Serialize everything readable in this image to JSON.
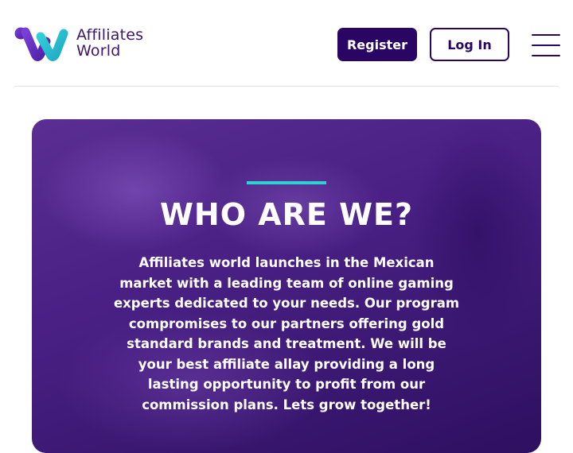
{
  "header": {
    "brand": {
      "line1": "Affiliates",
      "line2": "World"
    },
    "register_label": "Register",
    "login_label": "Log In"
  },
  "hero": {
    "title": "WHO ARE WE?",
    "body": "Affiliates world launches in the Mexican market with a leading team of online gaming experts dedicated to your needs. Our program compromises to our partners offering gold standard brands and treatment. We will be your best affiliate allay providing a long lasting opportunity to profit from our commission plans. Lets grow together!"
  },
  "colors": {
    "brand_purple": "#2a0664",
    "accent_cyan": "#2dd3d3",
    "hero_purple": "#4a2085"
  },
  "icons": [
    "logo-mark",
    "hamburger-menu-icon"
  ]
}
